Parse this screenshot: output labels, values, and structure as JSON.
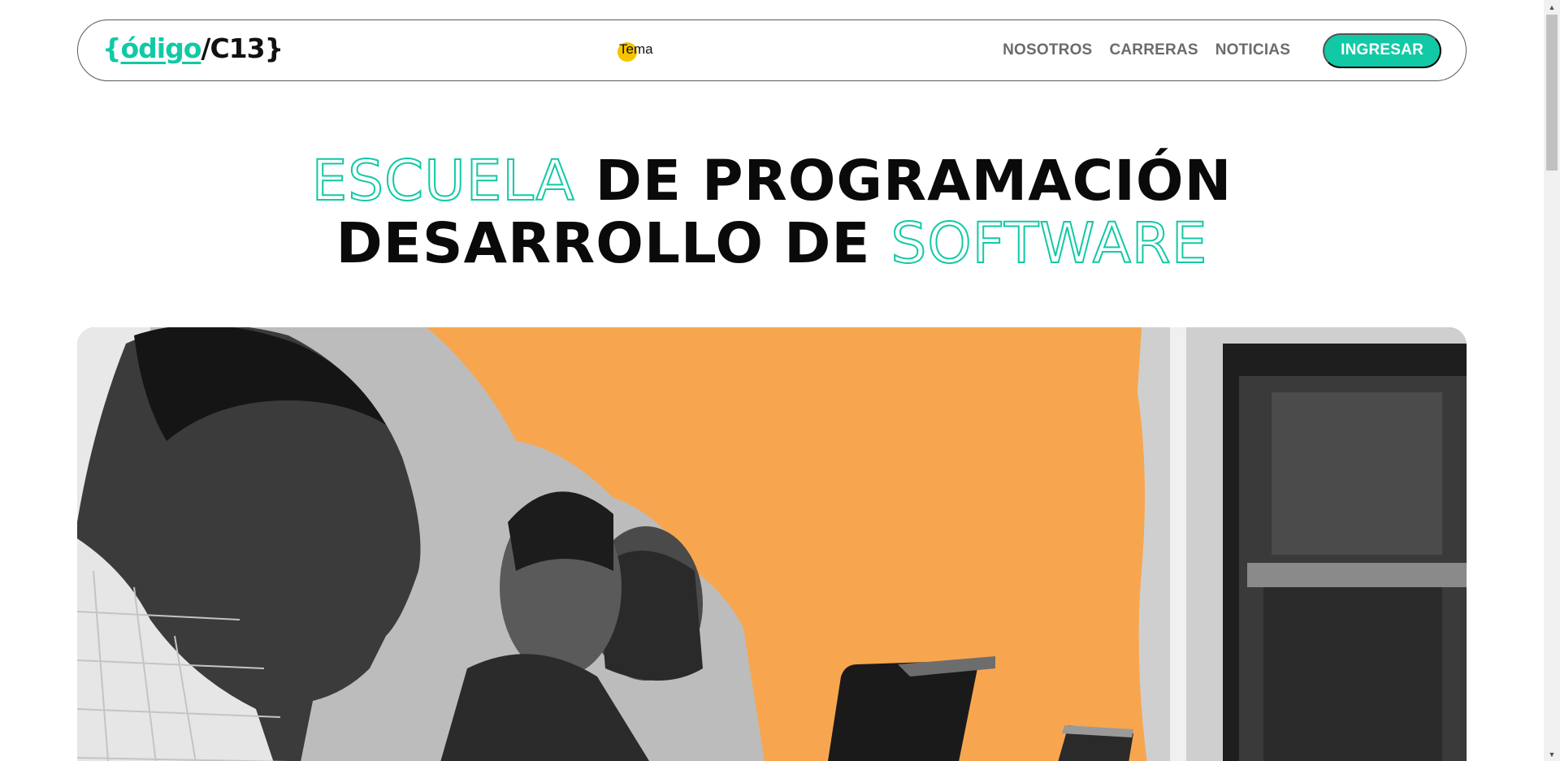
{
  "header": {
    "logo": {
      "open_brace": "{",
      "brand": "ódigo",
      "slash": "/",
      "code": "C13",
      "close_brace": "}"
    },
    "theme_toggle_label": "Tema",
    "nav": [
      "NOSOTROS",
      "CARRERAS",
      "NOTICIAS"
    ],
    "login_label": "INGRESAR"
  },
  "hero": {
    "line1_outline": "ESCUELA",
    "line1_solid": "DE PROGRAMACIÓN",
    "line2_solid": "DESARROLLO DE",
    "line2_outline": "SOFTWARE"
  },
  "colors": {
    "accent": "#12c9a6",
    "hero_background": "#f5a24f",
    "theme_dot": "#f5c400"
  }
}
